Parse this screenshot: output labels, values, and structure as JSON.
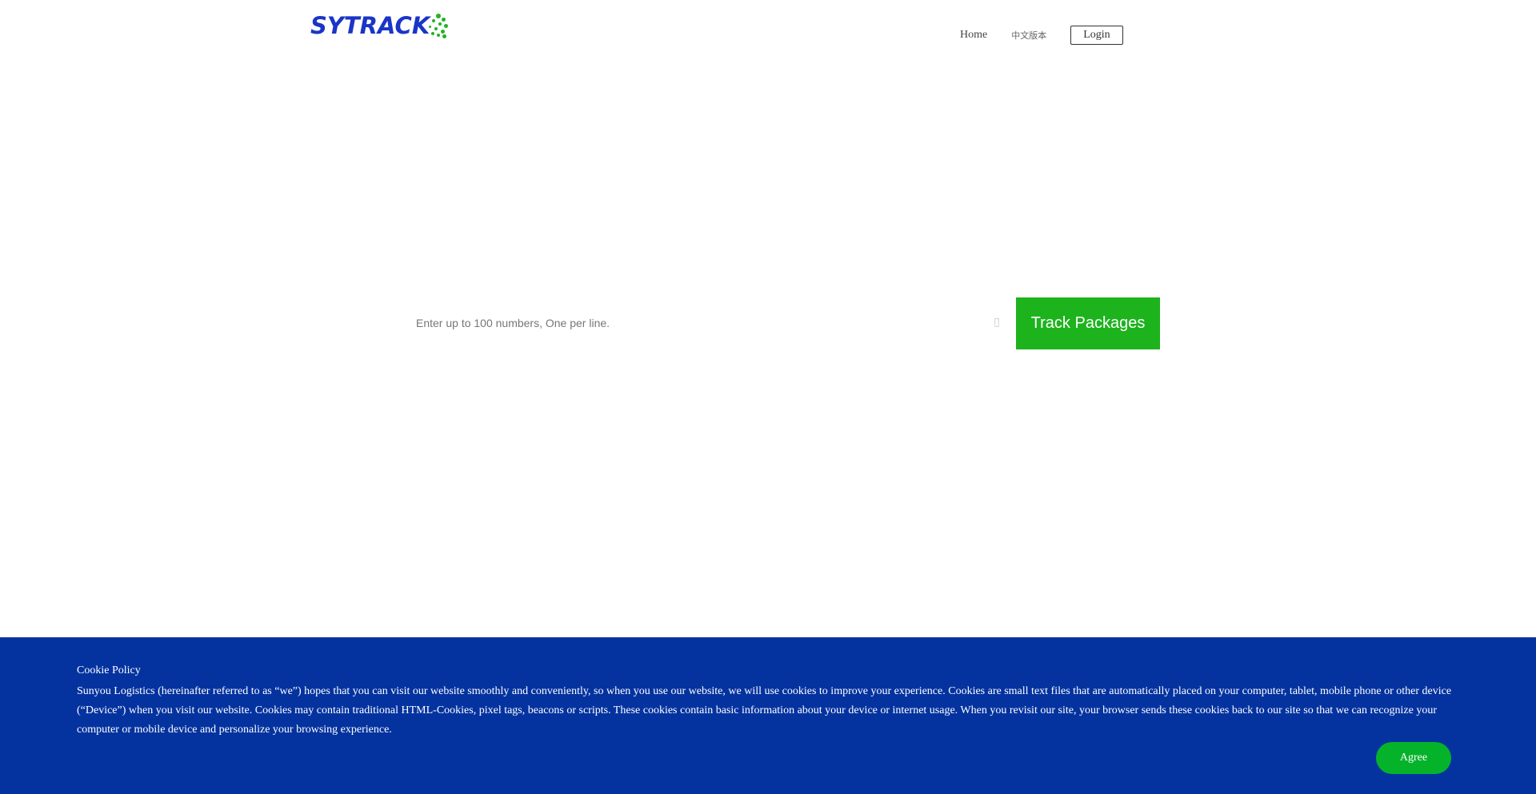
{
  "header": {
    "logo_text": "SYTRACK",
    "nav": {
      "home": "Home",
      "language": "中文版本",
      "login": "Login"
    }
  },
  "search": {
    "placeholder": "Enter up to 100 numbers, One per line.",
    "value": "",
    "clear_icon": "close-icon",
    "track_label": "Track Packages"
  },
  "cookie": {
    "title": "Cookie Policy",
    "text": "Sunyou Logistics (hereinafter referred to as “we”) hopes that you can visit our website smoothly and conveniently, so when you use our website, we will use cookies to improve your experience. Cookies are small text files that are automatically placed on your computer, tablet, mobile phone or other device (“Device”) when you visit our website. Cookies may contain traditional HTML-Cookies, pixel tags, beacons or scripts. These cookies contain basic information about your device or internet usage. When you revisit our site, your browser sends these cookies back to our site so that we can recognize your computer or mobile device and personalize your browsing experience.",
    "agree_label": "Agree"
  },
  "colors": {
    "brand_blue": "#1a35c6",
    "brand_green": "#1db31d",
    "banner_blue": "#0433a0",
    "agree_green": "#04b32a"
  }
}
